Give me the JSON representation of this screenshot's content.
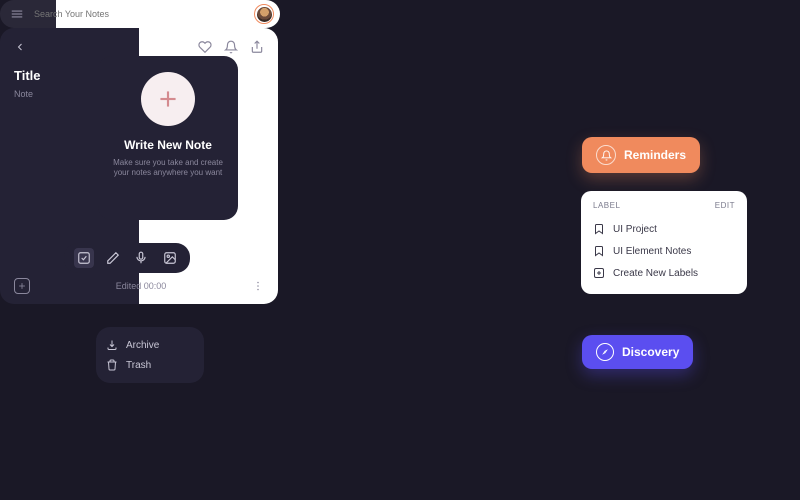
{
  "newNote": {
    "title": "Write New Note",
    "description": "Make sure you take and create your notes anywhere you want"
  },
  "search": {
    "placeholder": "Search Your Notes"
  },
  "editor": {
    "titlePlaceholder": "Title",
    "notePlaceholder": "Note",
    "editedLabel": "Edited 00:00"
  },
  "menu": {
    "archive": "Archive",
    "trash": "Trash"
  },
  "reminders": {
    "label": "Reminders"
  },
  "labels": {
    "header": "LABEL",
    "editLabel": "EDIT",
    "items": [
      {
        "label": "UI Project"
      },
      {
        "label": "UI Element Notes"
      },
      {
        "label": "Create New Labels"
      }
    ]
  },
  "discovery": {
    "label": "Discovery"
  },
  "colors": {
    "accentOrange": "#f08a5d",
    "accentPurple": "#5b4ef0",
    "panelDark": "#242235",
    "bg": "#1a1826"
  }
}
